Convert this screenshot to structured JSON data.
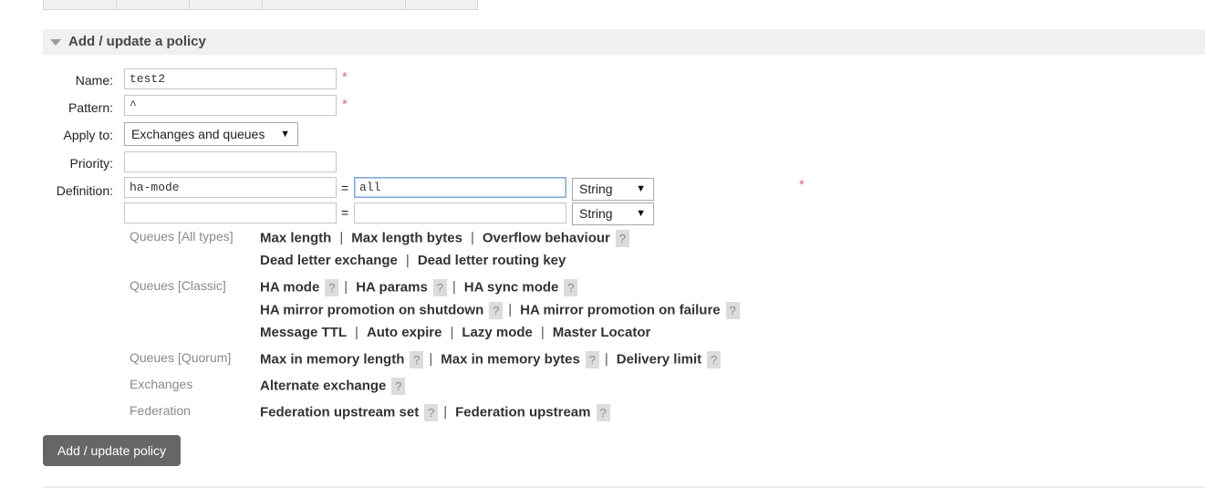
{
  "section": {
    "title": "Add / update a policy"
  },
  "form": {
    "name": {
      "label": "Name:",
      "value": "test2"
    },
    "pattern": {
      "label": "Pattern:",
      "value": "^"
    },
    "apply_to": {
      "label": "Apply to:",
      "selected": "Exchanges and queues"
    },
    "priority": {
      "label": "Priority:",
      "value": ""
    },
    "definition": {
      "label": "Definition:",
      "rows": [
        {
          "key": "ha-mode",
          "value": "all",
          "type": "String"
        },
        {
          "key": "",
          "value": "",
          "type": "String"
        }
      ],
      "equals": "="
    },
    "required_mark": "*"
  },
  "help": {
    "qmark": "?",
    "queues_all": {
      "label": "Queues [All types]",
      "links": [
        "Max length",
        "Max length bytes",
        "Overflow behaviour",
        "Dead letter exchange",
        "Dead letter routing key"
      ]
    },
    "queues_classic": {
      "label": "Queues [Classic]",
      "links": [
        "HA mode",
        "HA params",
        "HA sync mode",
        "HA mirror promotion on shutdown",
        "HA mirror promotion on failure",
        "Message TTL",
        "Auto expire",
        "Lazy mode",
        "Master Locator"
      ]
    },
    "queues_quorum": {
      "label": "Queues [Quorum]",
      "links": [
        "Max in memory length",
        "Max in memory bytes",
        "Delivery limit"
      ]
    },
    "exchanges": {
      "label": "Exchanges",
      "links": [
        "Alternate exchange"
      ]
    },
    "federation": {
      "label": "Federation",
      "links": [
        "Federation upstream set",
        "Federation upstream"
      ]
    }
  },
  "submit_label": "Add / update policy"
}
